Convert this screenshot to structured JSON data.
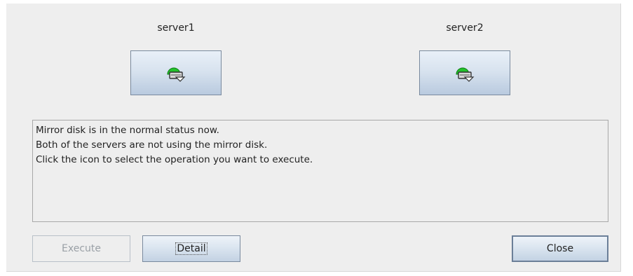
{
  "servers": [
    {
      "name": "server1",
      "icon": "mirror-disk-normal-icon"
    },
    {
      "name": "server2",
      "icon": "mirror-disk-normal-icon"
    }
  ],
  "message": {
    "lines": [
      "Mirror disk is in the normal status now.",
      "Both of the servers are not using the mirror disk.",
      "Click the icon to select the operation you want to execute."
    ]
  },
  "buttons": {
    "execute_label": "Execute",
    "detail_label": "Detail",
    "close_label": "Close"
  },
  "colors": {
    "status_green": "#22c22a",
    "dialog_bg": "#eeeeee"
  }
}
